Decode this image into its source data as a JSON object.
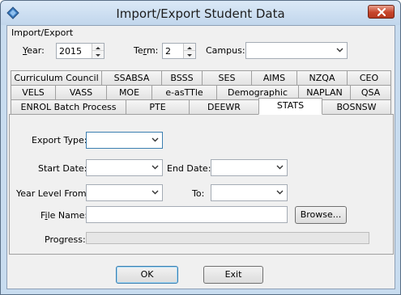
{
  "window": {
    "title": "Import/Export Student Data"
  },
  "group": {
    "label": "Import/Export"
  },
  "year": {
    "label_u": "Y",
    "label_rest": "ear:",
    "value": "2015"
  },
  "term": {
    "label_pre": "Te",
    "label_u": "r",
    "label_rest": "m:",
    "value": "2"
  },
  "campus": {
    "label": "Campus:",
    "value": ""
  },
  "tabs": {
    "row1": [
      "Curriculum Council",
      "SSABSA",
      "BSSS",
      "SES",
      "AIMS",
      "NZQA",
      "CEO"
    ],
    "row2": [
      "VELS",
      "VASS",
      "MOE",
      "e-asTTle",
      "Demographic",
      "NAPLAN",
      "QSA"
    ],
    "row3": [
      "ENROL Batch Process",
      "PTE",
      "DEEWR",
      "STATS",
      "BOSNSW"
    ],
    "active": "STATS"
  },
  "stats": {
    "export_type_label": "Export Type:",
    "export_type_value": "",
    "start_date_label": "Start Date:",
    "start_date_value": "",
    "end_date_label": "End Date:",
    "end_date_value": "",
    "year_from_label": "Year Level From:",
    "year_from_value": "",
    "to_label": "To:",
    "to_value": "",
    "file_name_label_pre": "F",
    "file_name_label_u": "i",
    "file_name_label_rest": "le Name:",
    "file_name_value": "",
    "browse_label": "Browse...",
    "progress_label": "Progress:",
    "progress_value": 0
  },
  "buttons": {
    "ok": "OK",
    "exit": "Exit"
  },
  "colors": {
    "title_bar": "#c8dcef",
    "close": "#c7452b",
    "default_border": "#3c7fb1"
  }
}
